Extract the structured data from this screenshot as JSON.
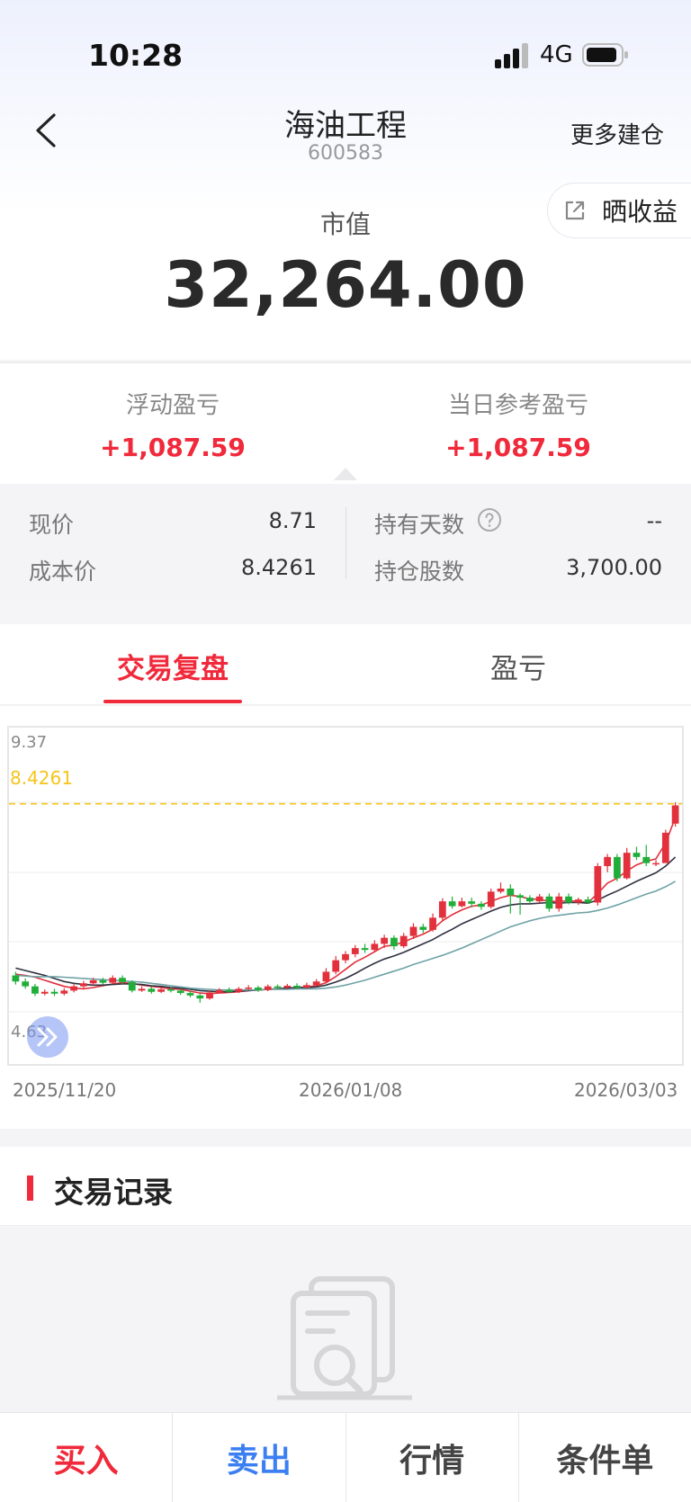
{
  "status_bar": {
    "time": "10:28",
    "network": "4G"
  },
  "header": {
    "title": "海油工程",
    "code": "600583",
    "more_label": "更多建仓"
  },
  "share_button": {
    "label": "晒收益",
    "icon": "share-icon"
  },
  "market_value": {
    "label": "市值",
    "value": "32,264.00"
  },
  "pl": {
    "floating": {
      "label": "浮动盈亏",
      "value": "+1,087.59"
    },
    "daily": {
      "label": "当日参考盈亏",
      "value": "+1,087.59"
    }
  },
  "info": {
    "current_price": {
      "label": "现价",
      "value": "8.71"
    },
    "cost_price": {
      "label": "成本价",
      "value": "8.4261"
    },
    "holding_days": {
      "label": "持有天数",
      "value": "--"
    },
    "shares": {
      "label": "持仓股数",
      "value": "3,700.00"
    }
  },
  "tabs": [
    {
      "label": "交易复盘",
      "active": true
    },
    {
      "label": "盈亏",
      "active": false
    }
  ],
  "chart_data": {
    "type": "candlestick",
    "ylim": [
      4.63,
      9.37
    ],
    "reference_line": {
      "label": "8.4261",
      "value": 8.4261,
      "color": "#f5c518"
    },
    "x_tick_labels": [
      "2025/11/20",
      "2026/01/08",
      "2026/03/03"
    ],
    "y_tick_labels": [
      "9.37",
      "4.63"
    ],
    "candles": [
      {
        "o": 5.6,
        "c": 5.5,
        "h": 5.66,
        "l": 5.45
      },
      {
        "o": 5.5,
        "c": 5.42,
        "h": 5.55,
        "l": 5.38
      },
      {
        "o": 5.42,
        "c": 5.3,
        "h": 5.46,
        "l": 5.26
      },
      {
        "o": 5.3,
        "c": 5.33,
        "h": 5.37,
        "l": 5.27
      },
      {
        "o": 5.33,
        "c": 5.3,
        "h": 5.38,
        "l": 5.26
      },
      {
        "o": 5.3,
        "c": 5.35,
        "h": 5.39,
        "l": 5.27
      },
      {
        "o": 5.35,
        "c": 5.42,
        "h": 5.46,
        "l": 5.32
      },
      {
        "o": 5.42,
        "c": 5.47,
        "h": 5.51,
        "l": 5.39
      },
      {
        "o": 5.47,
        "c": 5.52,
        "h": 5.56,
        "l": 5.44
      },
      {
        "o": 5.52,
        "c": 5.48,
        "h": 5.56,
        "l": 5.45
      },
      {
        "o": 5.48,
        "c": 5.56,
        "h": 5.6,
        "l": 5.46
      },
      {
        "o": 5.56,
        "c": 5.49,
        "h": 5.6,
        "l": 5.46
      },
      {
        "o": 5.49,
        "c": 5.35,
        "h": 5.52,
        "l": 5.32
      },
      {
        "o": 5.35,
        "c": 5.38,
        "h": 5.42,
        "l": 5.33
      },
      {
        "o": 5.38,
        "c": 5.33,
        "h": 5.41,
        "l": 5.3
      },
      {
        "o": 5.33,
        "c": 5.37,
        "h": 5.4,
        "l": 5.31
      },
      {
        "o": 5.37,
        "c": 5.35,
        "h": 5.4,
        "l": 5.32
      },
      {
        "o": 5.35,
        "c": 5.31,
        "h": 5.38,
        "l": 5.28
      },
      {
        "o": 5.31,
        "c": 5.27,
        "h": 5.34,
        "l": 5.24
      },
      {
        "o": 5.27,
        "c": 5.22,
        "h": 5.3,
        "l": 5.15
      },
      {
        "o": 5.22,
        "c": 5.32,
        "h": 5.35,
        "l": 5.2
      },
      {
        "o": 5.32,
        "c": 5.36,
        "h": 5.39,
        "l": 5.3
      },
      {
        "o": 5.36,
        "c": 5.33,
        "h": 5.4,
        "l": 5.31
      },
      {
        "o": 5.33,
        "c": 5.38,
        "h": 5.41,
        "l": 5.31
      },
      {
        "o": 5.38,
        "c": 5.4,
        "h": 5.44,
        "l": 5.36
      },
      {
        "o": 5.4,
        "c": 5.36,
        "h": 5.43,
        "l": 5.33
      },
      {
        "o": 5.36,
        "c": 5.42,
        "h": 5.45,
        "l": 5.34
      },
      {
        "o": 5.42,
        "c": 5.4,
        "h": 5.45,
        "l": 5.37
      },
      {
        "o": 5.4,
        "c": 5.43,
        "h": 5.46,
        "l": 5.37
      },
      {
        "o": 5.43,
        "c": 5.4,
        "h": 5.47,
        "l": 5.37
      },
      {
        "o": 5.4,
        "c": 5.44,
        "h": 5.48,
        "l": 5.38
      },
      {
        "o": 5.44,
        "c": 5.5,
        "h": 5.54,
        "l": 5.42
      },
      {
        "o": 5.5,
        "c": 5.66,
        "h": 5.72,
        "l": 5.48
      },
      {
        "o": 5.66,
        "c": 5.85,
        "h": 5.92,
        "l": 5.62
      },
      {
        "o": 5.85,
        "c": 5.95,
        "h": 6.0,
        "l": 5.8
      },
      {
        "o": 5.95,
        "c": 6.05,
        "h": 6.1,
        "l": 5.9
      },
      {
        "o": 6.05,
        "c": 6.02,
        "h": 6.12,
        "l": 5.97
      },
      {
        "o": 6.02,
        "c": 6.12,
        "h": 6.18,
        "l": 5.98
      },
      {
        "o": 6.12,
        "c": 6.22,
        "h": 6.27,
        "l": 6.05
      },
      {
        "o": 6.22,
        "c": 6.08,
        "h": 6.26,
        "l": 6.02
      },
      {
        "o": 6.08,
        "c": 6.25,
        "h": 6.3,
        "l": 6.05
      },
      {
        "o": 6.25,
        "c": 6.4,
        "h": 6.46,
        "l": 6.2
      },
      {
        "o": 6.4,
        "c": 6.35,
        "h": 6.45,
        "l": 6.3
      },
      {
        "o": 6.35,
        "c": 6.55,
        "h": 6.62,
        "l": 6.32
      },
      {
        "o": 6.55,
        "c": 6.82,
        "h": 6.87,
        "l": 6.5
      },
      {
        "o": 6.82,
        "c": 6.74,
        "h": 6.9,
        "l": 6.7
      },
      {
        "o": 6.74,
        "c": 6.82,
        "h": 6.88,
        "l": 6.72
      },
      {
        "o": 6.82,
        "c": 6.78,
        "h": 6.88,
        "l": 6.72
      },
      {
        "o": 6.78,
        "c": 6.73,
        "h": 6.82,
        "l": 6.68
      },
      {
        "o": 6.73,
        "c": 6.98,
        "h": 7.03,
        "l": 6.7
      },
      {
        "o": 6.98,
        "c": 7.03,
        "h": 7.13,
        "l": 6.95
      },
      {
        "o": 7.03,
        "c": 6.92,
        "h": 7.1,
        "l": 6.62
      },
      {
        "o": 6.92,
        "c": 6.88,
        "h": 6.95,
        "l": 6.6
      },
      {
        "o": 6.88,
        "c": 6.82,
        "h": 6.92,
        "l": 6.78
      },
      {
        "o": 6.82,
        "c": 6.9,
        "h": 6.94,
        "l": 6.79
      },
      {
        "o": 6.9,
        "c": 6.7,
        "h": 6.95,
        "l": 6.65
      },
      {
        "o": 6.7,
        "c": 6.9,
        "h": 6.96,
        "l": 6.65
      },
      {
        "o": 6.9,
        "c": 6.8,
        "h": 6.95,
        "l": 6.77
      },
      {
        "o": 6.8,
        "c": 6.85,
        "h": 6.88,
        "l": 6.76
      },
      {
        "o": 6.85,
        "c": 6.8,
        "h": 6.9,
        "l": 6.78
      },
      {
        "o": 6.8,
        "c": 7.4,
        "h": 7.45,
        "l": 6.75
      },
      {
        "o": 7.4,
        "c": 7.55,
        "h": 7.6,
        "l": 7.3
      },
      {
        "o": 7.55,
        "c": 7.2,
        "h": 7.6,
        "l": 7.15
      },
      {
        "o": 7.2,
        "c": 7.62,
        "h": 7.7,
        "l": 7.18
      },
      {
        "o": 7.62,
        "c": 7.55,
        "h": 7.72,
        "l": 7.5
      },
      {
        "o": 7.55,
        "c": 7.45,
        "h": 7.75,
        "l": 7.4
      },
      {
        "o": 7.45,
        "c": 7.45,
        "h": 7.5,
        "l": 7.4
      },
      {
        "o": 7.45,
        "c": 7.95,
        "h": 8.0,
        "l": 7.7
      },
      {
        "o": 8.1,
        "c": 8.4,
        "h": 8.45,
        "l": 8.05
      }
    ],
    "moving_averages": [
      {
        "color": "#e2303c",
        "values": [
          5.62,
          5.6,
          5.57,
          5.52,
          5.47,
          5.42,
          5.39,
          5.38,
          5.4,
          5.43,
          5.46,
          5.48,
          5.47,
          5.44,
          5.42,
          5.4,
          5.38,
          5.37,
          5.34,
          5.31,
          5.3,
          5.31,
          5.32,
          5.33,
          5.35,
          5.36,
          5.37,
          5.38,
          5.39,
          5.4,
          5.41,
          5.43,
          5.48,
          5.58,
          5.7,
          5.82,
          5.9,
          5.99,
          6.08,
          6.1,
          6.15,
          6.22,
          6.28,
          6.36,
          6.5,
          6.6,
          6.68,
          6.74,
          6.76,
          6.82,
          6.88,
          6.92,
          6.9,
          6.86,
          6.85,
          6.82,
          6.82,
          6.83,
          6.82,
          6.8,
          6.95,
          7.12,
          7.2,
          7.32,
          7.42,
          7.48,
          7.52,
          7.78,
          8.2
        ]
      },
      {
        "color": "#2f3140",
        "values": [
          5.72,
          5.68,
          5.64,
          5.6,
          5.55,
          5.5,
          5.47,
          5.45,
          5.44,
          5.44,
          5.45,
          5.46,
          5.46,
          5.45,
          5.43,
          5.42,
          5.4,
          5.39,
          5.37,
          5.35,
          5.34,
          5.33,
          5.33,
          5.34,
          5.35,
          5.36,
          5.37,
          5.38,
          5.39,
          5.4,
          5.4,
          5.41,
          5.44,
          5.49,
          5.55,
          5.63,
          5.72,
          5.8,
          5.87,
          5.92,
          5.98,
          6.05,
          6.12,
          6.19,
          6.28,
          6.36,
          6.45,
          6.52,
          6.59,
          6.66,
          6.72,
          6.76,
          6.78,
          6.78,
          6.79,
          6.8,
          6.79,
          6.8,
          6.8,
          6.79,
          6.84,
          6.92,
          6.99,
          7.07,
          7.15,
          7.22,
          7.29,
          7.4,
          7.55
        ]
      },
      {
        "color": "#6fa2a6",
        "values": [
          5.6,
          5.59,
          5.58,
          5.58,
          5.58,
          5.57,
          5.56,
          5.55,
          5.54,
          5.53,
          5.52,
          5.51,
          5.5,
          5.49,
          5.47,
          5.45,
          5.43,
          5.41,
          5.39,
          5.38,
          5.37,
          5.36,
          5.36,
          5.36,
          5.36,
          5.36,
          5.37,
          5.37,
          5.37,
          5.38,
          5.38,
          5.38,
          5.39,
          5.41,
          5.44,
          5.48,
          5.52,
          5.57,
          5.62,
          5.67,
          5.72,
          5.78,
          5.83,
          5.88,
          5.93,
          5.99,
          6.05,
          6.12,
          6.19,
          6.26,
          6.33,
          6.4,
          6.45,
          6.5,
          6.54,
          6.57,
          6.59,
          6.61,
          6.63,
          6.64,
          6.67,
          6.71,
          6.76,
          6.82,
          6.88,
          6.94,
          6.99,
          7.06,
          7.15
        ]
      }
    ]
  },
  "records": {
    "title": "交易记录"
  },
  "bottom_actions": [
    {
      "label": "买入",
      "color": "#f0293b"
    },
    {
      "label": "卖出",
      "color": "#3b7ff2"
    },
    {
      "label": "行情",
      "color": "#444444"
    },
    {
      "label": "条件单",
      "color": "#444444"
    }
  ]
}
